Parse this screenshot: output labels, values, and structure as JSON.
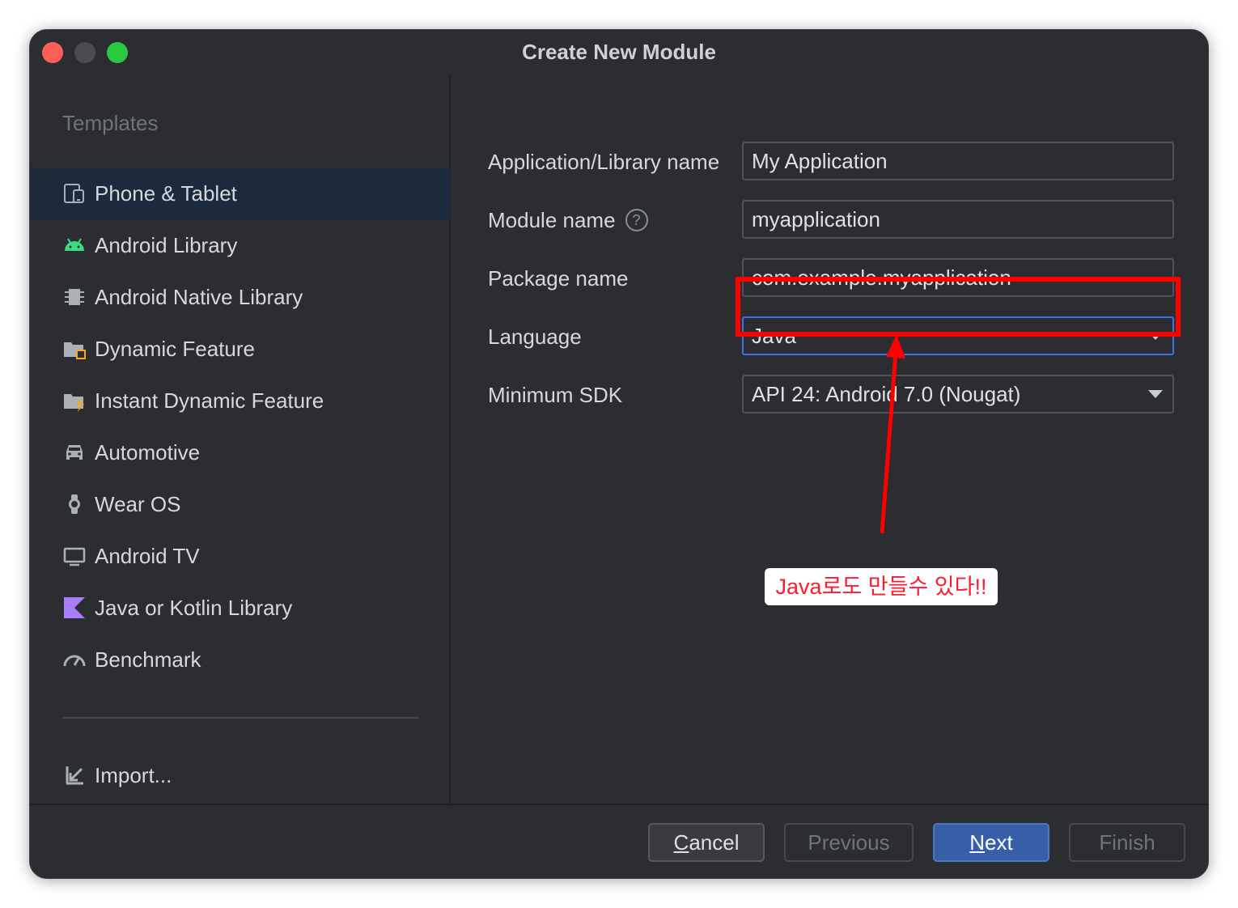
{
  "window": {
    "title": "Create New Module"
  },
  "sidebar": {
    "heading": "Templates",
    "items": [
      {
        "label": "Phone & Tablet",
        "icon": "phone-tablet-icon"
      },
      {
        "label": "Android Library",
        "icon": "android-icon"
      },
      {
        "label": "Android Native Library",
        "icon": "chip-icon"
      },
      {
        "label": "Dynamic Feature",
        "icon": "folder-module-icon"
      },
      {
        "label": "Instant Dynamic Feature",
        "icon": "folder-instant-icon"
      },
      {
        "label": "Automotive",
        "icon": "car-icon"
      },
      {
        "label": "Wear OS",
        "icon": "watch-icon"
      },
      {
        "label": "Android TV",
        "icon": "tv-icon"
      },
      {
        "label": "Java or Kotlin Library",
        "icon": "kotlin-icon"
      },
      {
        "label": "Benchmark",
        "icon": "gauge-icon"
      }
    ],
    "selected_index": 0,
    "import_label": "Import..."
  },
  "form": {
    "app_name_label": "Application/Library name",
    "app_name_value": "My Application",
    "module_name_label": "Module name",
    "module_name_value": "myapplication",
    "package_name_label": "Package name",
    "package_name_value": "com.example.myapplication",
    "language_label": "Language",
    "language_value": "Java",
    "min_sdk_label": "Minimum SDK",
    "min_sdk_value": "API 24: Android 7.0 (Nougat)"
  },
  "annotation": {
    "note": "Java로도 만들수 있다!!",
    "color": "#ff0000"
  },
  "footer": {
    "cancel_mnemonic": "C",
    "cancel_rest": "ancel",
    "previous_label": "Previous",
    "next_mnemonic": "N",
    "next_rest": "ext",
    "finish_label": "Finish"
  },
  "colors": {
    "background": "#2b2d30",
    "selected_item": "#1d2a3c",
    "primary_button": "#365fa7",
    "android_green": "#3ddc84",
    "kotlin_purple": "#a97bff"
  }
}
